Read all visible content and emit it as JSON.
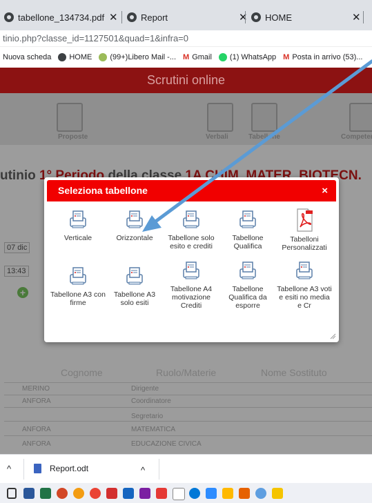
{
  "browser": {
    "tabs": [
      {
        "title": "tabellone_134734.pdf"
      },
      {
        "title": "Report"
      },
      {
        "title": "HOME"
      }
    ],
    "address": "tinio.php?classe_id=1127501&quad=1&infra=0",
    "bookmarks": [
      {
        "label": "Nuova scheda"
      },
      {
        "label": "HOME"
      },
      {
        "label": "(99+)Libero Mail -..."
      },
      {
        "label": "Gmail"
      },
      {
        "label": "(1) WhatsApp"
      },
      {
        "label": "Posta in arrivo (53)..."
      }
    ],
    "colors": {
      "tab_bar": "#dee1e6",
      "gmail_red": "#d93025",
      "whatsapp_green": "#25d366"
    }
  },
  "page": {
    "header_title": "Scrutini online",
    "header_color": "#8c1212",
    "nav": [
      {
        "label": "Proposte"
      },
      {
        "label": "Verbali"
      },
      {
        "label": "Tabellone"
      },
      {
        "label": "Competenze"
      }
    ],
    "title_prefix": "utinio ",
    "title_period": "1° Periodo",
    "title_middle": " della classe ",
    "title_class": "1A CHIM. MATER. BIOTECN.",
    "date_value": "07 dic",
    "time_value": "13:43",
    "table": {
      "headers": [
        "Cognome",
        "Ruolo/Materie",
        "Nome Sostituto"
      ],
      "rows": [
        {
          "cognome": "MERINO",
          "ruolo": "Dirigente"
        },
        {
          "cognome": "ANFORA",
          "ruolo": "Coordinatore"
        },
        {
          "cognome": "",
          "ruolo": "Segretario"
        },
        {
          "cognome": "ANFORA",
          "ruolo": "MATEMATICA"
        },
        {
          "cognome": "ANFORA",
          "ruolo": "EDUCAZIONE CIVICA"
        }
      ]
    }
  },
  "modal": {
    "title": "Seleziona tabellone",
    "close": "×",
    "header_color": "#f10000",
    "options": [
      {
        "label": "Verticale",
        "icon": "printer-icon"
      },
      {
        "label": "Orizzontale",
        "icon": "printer-icon"
      },
      {
        "label": "Tabellone solo esito e crediti",
        "icon": "printer-icon"
      },
      {
        "label": "Tabellone Qualifica",
        "icon": "printer-icon"
      },
      {
        "label": "Tabelloni Personalizzati",
        "icon": "pdf-icon"
      },
      {
        "label": "Tabellone A3 con firme",
        "icon": "printer-icon"
      },
      {
        "label": "Tabellone A3 solo esiti",
        "icon": "printer-icon"
      },
      {
        "label": "Tabellone A4 motivazione Crediti",
        "icon": "printer-icon"
      },
      {
        "label": "Tabellone Qualifica da esporre",
        "icon": "printer-icon"
      },
      {
        "label": "Tabellone A3 voti e esiti no media e Cr",
        "icon": "printer-icon"
      }
    ]
  },
  "annotation": {
    "arrow_color": "#5b9bd5"
  },
  "downloads": {
    "file": "Report.odt"
  }
}
